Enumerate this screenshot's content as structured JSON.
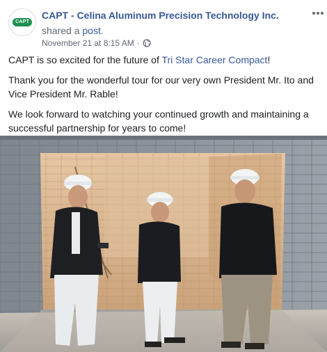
{
  "post": {
    "page_name": "CAPT - Celina Aluminum Precision Technology Inc.",
    "avatar_text": "CAPT",
    "shared_prefix": "shared a ",
    "shared_link": "post",
    "shared_suffix": ".",
    "timestamp": "November 21 at 8:15 AM",
    "meta_separator": "·",
    "privacy_icon": "globe-icon",
    "more_icon": "ellipsis-icon",
    "paragraphs": [
      {
        "before": "CAPT is so excited for the future of ",
        "mention": "Tri Star Career Compact",
        "after": "!"
      },
      {
        "text": "Thank you for the wonderful tour for our very own President Mr. Ito and Vice President Mr. Rable!"
      },
      {
        "text": "We look forward to watching your continued growth and maintaining a successful partnership for years to come!"
      }
    ]
  },
  "colors": {
    "link": "#385898",
    "secondary_text": "#616770",
    "primary_text": "#1c1e21",
    "brand_green": "#1f8f4e"
  }
}
